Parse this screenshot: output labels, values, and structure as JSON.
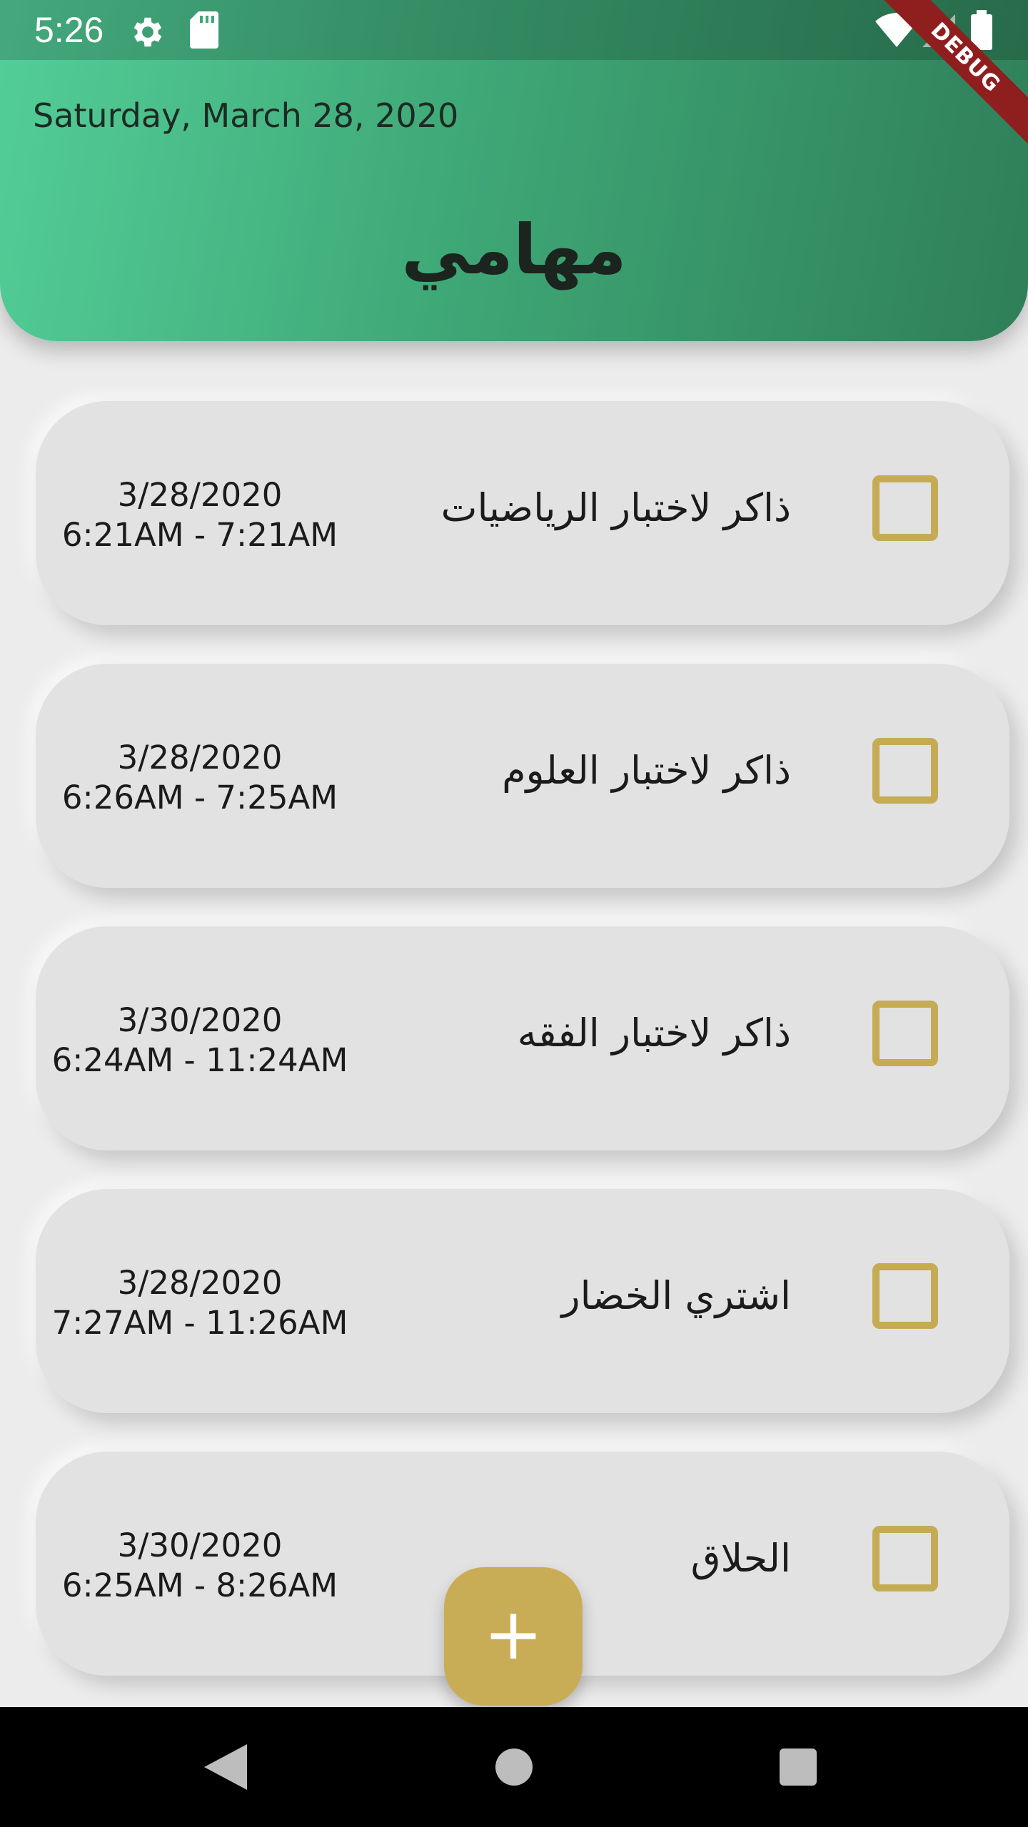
{
  "status_bar": {
    "time": "5:26",
    "icons": [
      "gear-icon",
      "sd-card-icon",
      "wifi-icon",
      "signal-icon",
      "battery-icon"
    ]
  },
  "debug_banner": "DEBUG",
  "header": {
    "date": "Saturday, March 28, 2020",
    "title": "مهامي"
  },
  "tasks": [
    {
      "title": "ذاكر لاختبار الرياضيات",
      "date": "3/28/2020",
      "time": "6:21AM - 7:21AM",
      "checked": false
    },
    {
      "title": "ذاكر لاختبار العلوم",
      "date": "3/28/2020",
      "time": "6:26AM - 7:25AM",
      "checked": false
    },
    {
      "title": "ذاكر لاختبار الفقه",
      "date": "3/30/2020",
      "time": "6:24AM - 11:24AM",
      "checked": false
    },
    {
      "title": "اشتري الخضار",
      "date": "3/28/2020",
      "time": "7:27AM - 11:26AM",
      "checked": false
    },
    {
      "title": "الحلاق",
      "date": "3/30/2020",
      "time": "6:25AM - 8:26AM",
      "checked": false
    }
  ],
  "fab": {
    "label": "+",
    "icon": "plus-icon"
  },
  "nav": {
    "icons": [
      "back-icon",
      "home-icon",
      "recents-icon"
    ]
  },
  "colors": {
    "header_gradient_start": "#53ce98",
    "header_gradient_end": "#2f7f58",
    "accent_gold": "#c6ab55",
    "card_background": "#e2e2e2",
    "page_background": "#ececec",
    "debug_red": "#8f1f1f"
  }
}
